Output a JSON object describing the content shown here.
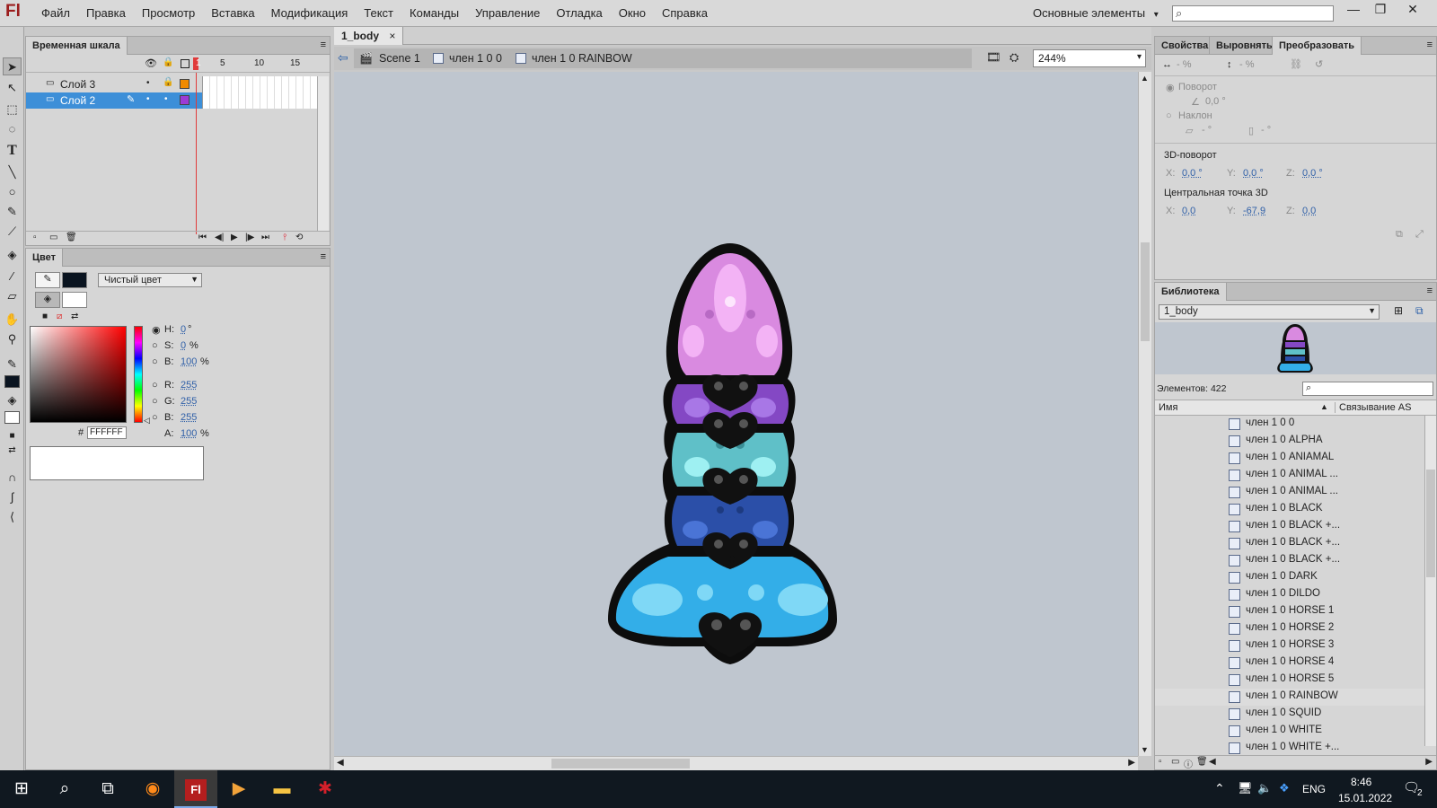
{
  "app": {
    "logo": "Fl",
    "workspace": "Основные элементы",
    "workspace_caret": "▾"
  },
  "menu": [
    "Файл",
    "Правка",
    "Просмотр",
    "Вставка",
    "Модификация",
    "Текст",
    "Команды",
    "Управление",
    "Отладка",
    "Окно",
    "Справка"
  ],
  "window_controls": {
    "minimize": "—",
    "restore": "❐",
    "close": "✕"
  },
  "timeline": {
    "tab": "Временная шкала",
    "frame_numbers": [
      "1",
      "5",
      "10",
      "15"
    ],
    "layers": [
      {
        "name": "Слой 3",
        "color": "#f08a00",
        "selected": false
      },
      {
        "name": "Слой 2",
        "color": "#9b3bd6",
        "selected": true
      }
    ]
  },
  "document": {
    "tab": "1_body",
    "close": "×"
  },
  "breadcrumbs": [
    "Scene 1",
    "член 1 0 0",
    "член 1 0 RAINBOW"
  ],
  "zoom": "244%",
  "color_panel": {
    "tab": "Цвет",
    "fill_type": "Чистый цвет",
    "stroke_color": "#0a1420",
    "fill_color": "#ffffff",
    "hsb": {
      "h": "0",
      "h_unit": "°",
      "s": "0",
      "s_unit": "%",
      "b": "100",
      "b_unit": "%"
    },
    "rgb": {
      "r": "255",
      "g": "255",
      "b": "255"
    },
    "alpha": "100",
    "alpha_unit": "%",
    "hex": "FFFFFF",
    "hash": "#",
    "labels": {
      "h": "H:",
      "s": "S:",
      "b": "B:",
      "r": "R:",
      "g": "G:",
      "b2": "B:",
      "a": "A:"
    }
  },
  "transform_panel": {
    "tabs": [
      "Свойства",
      "Выровнять",
      "Преобразовать"
    ],
    "width_pct": "- %",
    "height_pct": "- %",
    "rotate_label": "Поворот",
    "rotate_value": "0,0 °",
    "skew_label": "Наклон",
    "skew_h": "- °",
    "skew_v": "- °",
    "rot3d_title": "3D-поворот",
    "rot3d": {
      "x": "0,0 °",
      "y": "0,0 °",
      "z": "0,0 °"
    },
    "center3d_title": "Центральная точка 3D",
    "center3d": {
      "x": "0,0",
      "y": "-67,9",
      "z": "0,0"
    },
    "axis_labels": {
      "x": "X:",
      "y": "Y:",
      "z": "Z:"
    }
  },
  "library": {
    "tab": "Библиотека",
    "doc": "1_body",
    "count": "Элементов: 422",
    "col_name": "Имя",
    "col_link": "Связывание AS",
    "selected_index": 16,
    "items": [
      "член 1 0 0",
      "член 1 0 ALPHA",
      "член 1 0 ANIAMAL",
      "член 1 0 ANIMAL ...",
      "член 1 0 ANIMAL ...",
      "член 1 0 BLACK",
      "член 1 0 BLACK +...",
      "член 1 0 BLACK +...",
      "член 1 0 BLACK +...",
      "член 1 0 DARK",
      "член 1 0 DILDO",
      "член 1 0 HORSE 1",
      "член 1 0 HORSE 2",
      "член 1 0 HORSE 3",
      "член 1 0 HORSE 4",
      "член 1 0 HORSE 5",
      "член 1 0 RAINBOW",
      "член 1 0 SQUID",
      "член 1 0 WHITE",
      "член 1 0 WHITE +..."
    ]
  },
  "taskbar": {
    "lang": "ENG",
    "time": "8:46",
    "date": "15.01.2022",
    "notif": "2"
  },
  "colors": {
    "stage": "#bfc6cf",
    "selection": "#3d8fd8",
    "accent": "#9b1c1c"
  }
}
